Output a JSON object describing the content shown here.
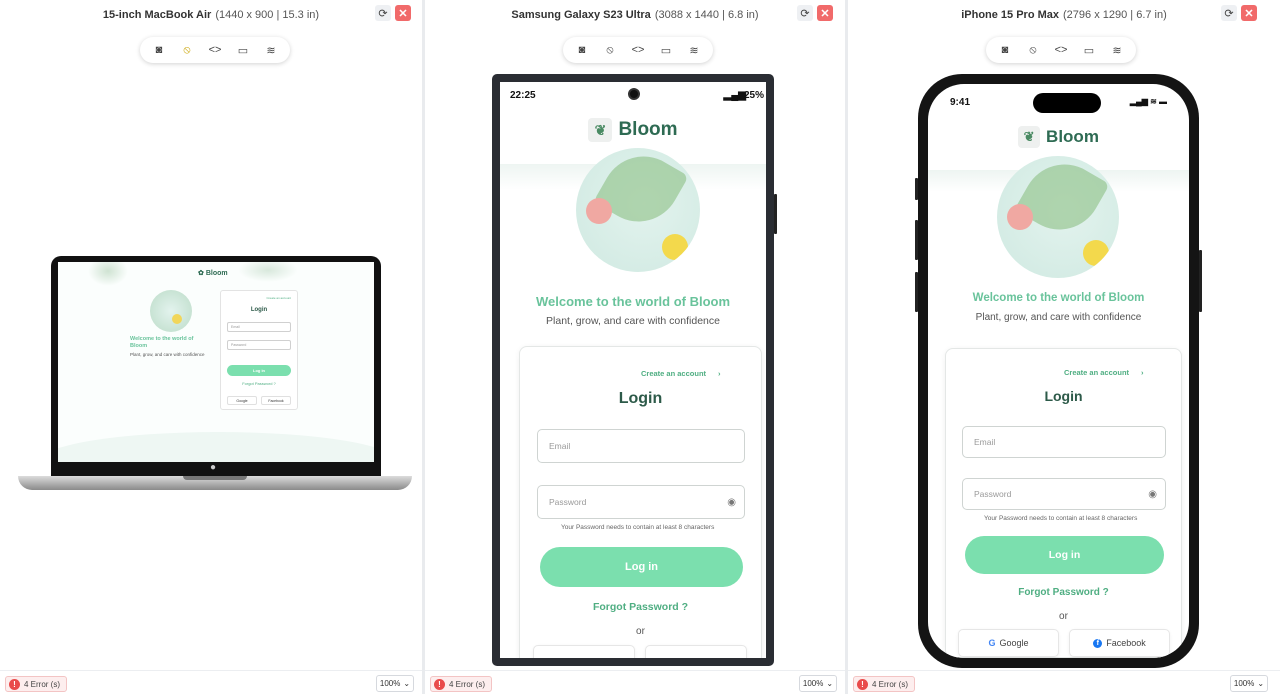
{
  "devices": [
    {
      "name": "15-inch MacBook Air",
      "spec": "(1440 x 900 | 15.3 in)"
    },
    {
      "name": "Samsung Galaxy S23 Ultra",
      "spec": "(3088 x 1440 | 6.8 in)"
    },
    {
      "name": "iPhone 15 Pro Max",
      "spec": "(2796 x 1290 | 6.7 in)"
    }
  ],
  "footer": {
    "errors": "4 Error (s)",
    "zoom": "100%"
  },
  "app": {
    "brand": "Bloom",
    "welcome": "Welcome to the world of Bloom",
    "tagline": "Plant, grow, and care with confidence",
    "create_account": "Create an account",
    "login_title": "Login",
    "email_placeholder": "Email",
    "password_placeholder": "Password",
    "password_hint": "Your Password needs to contain at least 8 characters",
    "login_button": "Log in",
    "forgot": "Forgot Password ?",
    "or": "or",
    "google": "Google",
    "facebook": "Facebook"
  },
  "laptop_welcome": "Welcome to the world of Bloom",
  "status": {
    "android_time": "22:25",
    "android_battery": "25%",
    "ios_time": "9:41"
  },
  "colors": {
    "accent": "#7bdfae",
    "brand_green": "#2e6b53",
    "welcome_green": "#69c39b",
    "close_red": "#f16a6a"
  }
}
